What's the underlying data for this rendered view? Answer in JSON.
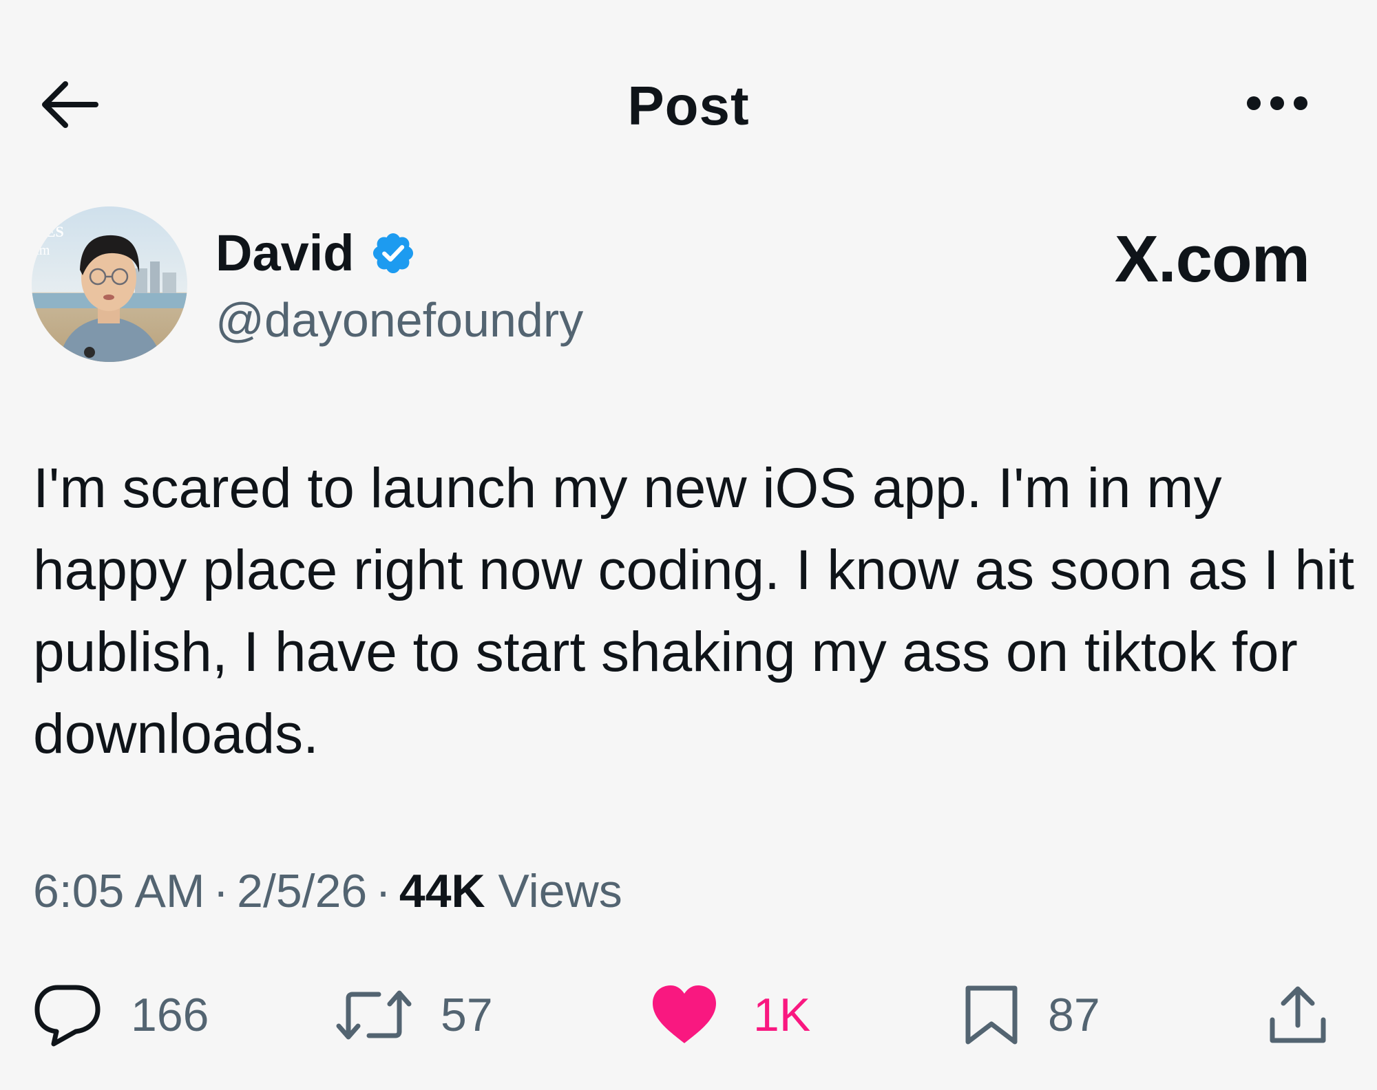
{
  "header": {
    "title": "Post",
    "back_icon": "arrow-left-icon",
    "more_icon": "more-horizontal-icon"
  },
  "author": {
    "name": "David",
    "handle": "@dayonefoundry",
    "verified": true,
    "verified_icon": "verified-badge-icon",
    "avatar": "profile-photo",
    "avatar_sign_text": [
      "CES",
      "am"
    ]
  },
  "brand": {
    "logo_text": "X.com"
  },
  "post": {
    "text": "I'm scared to launch my new iOS app. I'm in my happy place right now coding. I know as soon as I hit publish, I have to start shaking my ass on tiktok for downloads."
  },
  "meta": {
    "time": "6:05 AM",
    "date": "2/5/26",
    "views_count": "44K",
    "views_label": "Views",
    "separator": "·"
  },
  "actions": {
    "reply": {
      "icon": "reply-icon",
      "count": "166"
    },
    "repost": {
      "icon": "repost-icon",
      "count": "57"
    },
    "like": {
      "icon": "heart-filled-icon",
      "count": "1K"
    },
    "bookmark": {
      "icon": "bookmark-icon",
      "count": "87"
    },
    "share": {
      "icon": "share-icon"
    }
  },
  "colors": {
    "background": "#f6f6f6",
    "text": "#0f1419",
    "secondary_text": "#536471",
    "verified_blue": "#1d9bf0",
    "like_pink": "#f91880"
  }
}
